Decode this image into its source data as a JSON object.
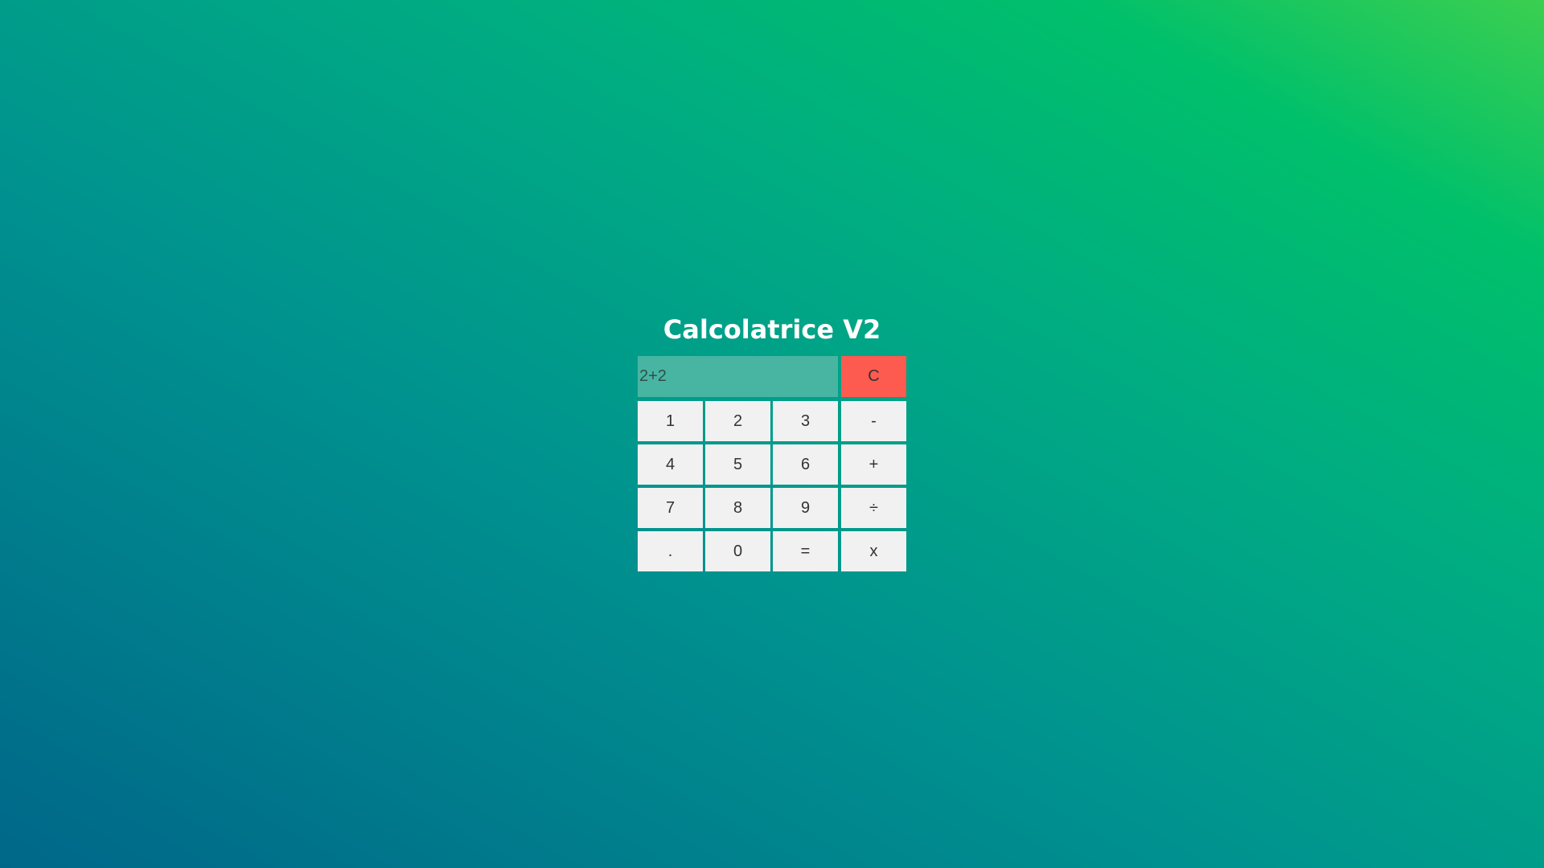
{
  "page": {
    "title": "Calcolatrice V2"
  },
  "display": {
    "value": "2+2"
  },
  "buttons": {
    "clear": "C",
    "one": "1",
    "two": "2",
    "three": "3",
    "minus": "-",
    "four": "4",
    "five": "5",
    "six": "6",
    "plus": "+",
    "seven": "7",
    "eight": "8",
    "nine": "9",
    "divide": "÷",
    "decimal": ".",
    "zero": "0",
    "equals": "=",
    "multiply": "x"
  },
  "colors": {
    "gradient_start": "#006789",
    "gradient_end": "#3bcf50",
    "display_background": "#48b5a3",
    "button_background": "#f1f1f1",
    "clear_button_background": "#fd5a50",
    "title_color": "#ffffff"
  }
}
